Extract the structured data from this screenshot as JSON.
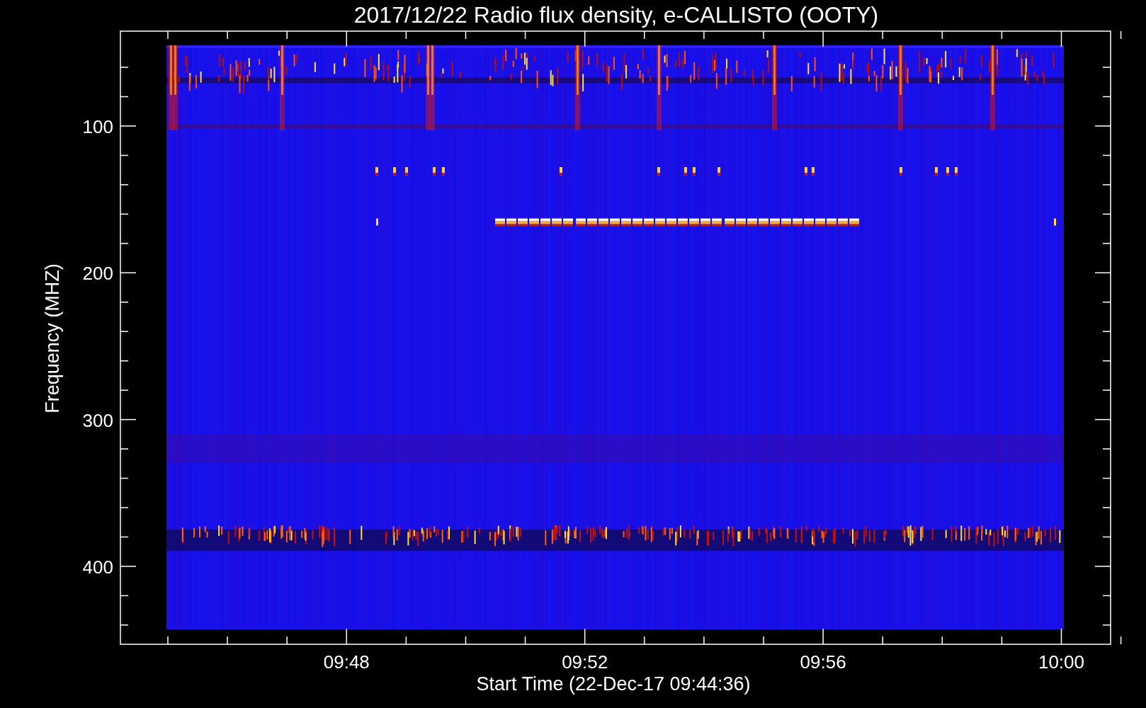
{
  "plot": {
    "title": "2017/12/22  Radio flux density, e-CALLISTO (OOTY)",
    "ylabel": "Frequency (MHZ)",
    "xlabel": "Start Time (22-Dec-17 09:44:36)",
    "yticks": [
      "100",
      "200",
      "300",
      "400"
    ],
    "xticks": [
      "09:48",
      "09:52",
      "09:56",
      "10:00"
    ]
  }
}
